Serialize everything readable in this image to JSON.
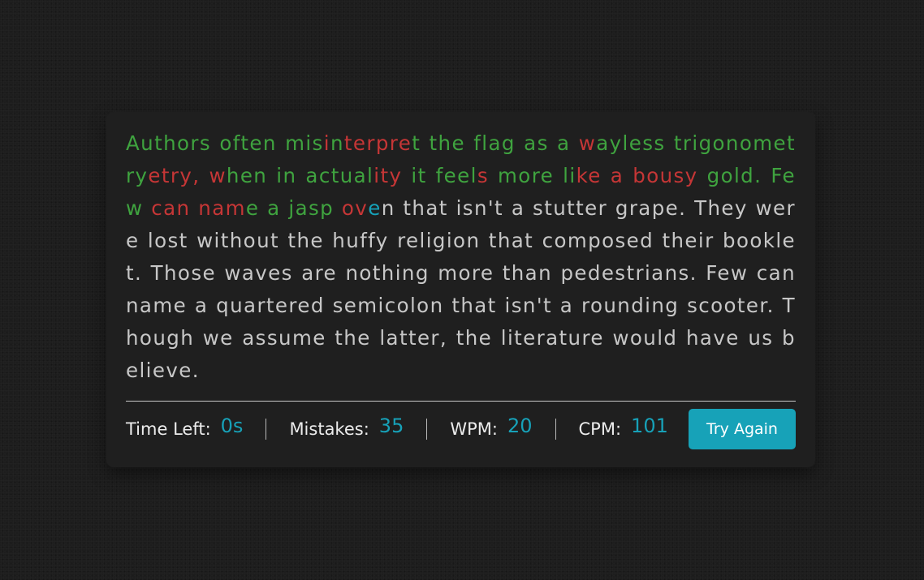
{
  "paragraph": {
    "segments": [
      {
        "text": "Authors often mis",
        "state": "correct"
      },
      {
        "text": "i",
        "state": "incorrect"
      },
      {
        "text": "n",
        "state": "correct"
      },
      {
        "text": "terpre",
        "state": "incorrect"
      },
      {
        "text": "t the flag as a ",
        "state": "correct"
      },
      {
        "text": "w",
        "state": "incorrect"
      },
      {
        "text": "ayless trigonometry",
        "state": "correct"
      },
      {
        "text": "etry, ",
        "state": "incorrect"
      },
      {
        "text": "w",
        "state": "incorrect"
      },
      {
        "text": "hen in actual",
        "state": "correct"
      },
      {
        "text": "ity",
        "state": "incorrect"
      },
      {
        "text": " it feel",
        "state": "correct"
      },
      {
        "text": "s",
        "state": "incorrect"
      },
      {
        "text": " more li",
        "state": "correct"
      },
      {
        "text": "ke",
        "state": "incorrect"
      },
      {
        "text": " a",
        "state": "incorrect"
      },
      {
        "text": " ",
        "state": "correct"
      },
      {
        "text": "bousy",
        "state": "incorrect"
      },
      {
        "text": " gold. Few ",
        "state": "correct"
      },
      {
        "text": "can nam",
        "state": "incorrect"
      },
      {
        "text": "e a jasp ",
        "state": "correct"
      },
      {
        "text": "ov",
        "state": "incorrect"
      },
      {
        "text": "e",
        "state": "active"
      },
      {
        "text": "n that isn't a stutter grape. They were lost without the huffy religion that composed their booklet. Those waves are nothing more than pedestrians. Few can name a quartered semicolon that isn't a rounding scooter. Though we assume the latter, the literature would have us believe.",
        "state": "pending"
      }
    ]
  },
  "stats": {
    "time_left_label": "Time Left:",
    "time_left_value": "0s",
    "mistakes_label": "Mistakes:",
    "mistakes_value": "35",
    "wpm_label": "WPM:",
    "wpm_value": "20",
    "cpm_label": "CPM:",
    "cpm_value": "101"
  },
  "button": {
    "label": "Try Again"
  },
  "colors": {
    "correct": "#3fa33f",
    "incorrect": "#c53636",
    "active": "#16a1b8",
    "pending": "#c7c7c7",
    "accent": "#17a2b8"
  }
}
